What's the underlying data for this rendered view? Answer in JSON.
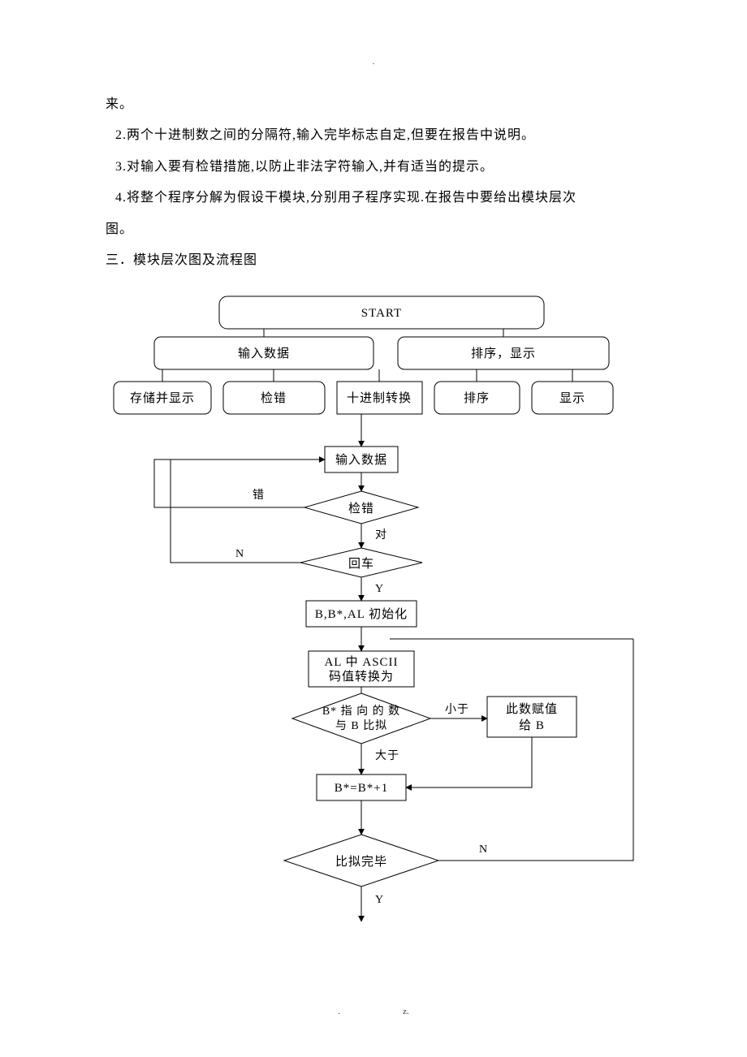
{
  "text": {
    "line0": "来。",
    "line1": "2.两个十进制数之间的分隔符,输入完毕标志自定,但要在报告中说明。",
    "line2": "3.对输入要有检错措施,以防止非法字符输入,并有适当的提示。",
    "line3": "4.将整个程序分解为假设干模块,分别用子程序实现.在报告中要给出模块层次",
    "line4": "图。",
    "sect": "三．模块层次图及流程图"
  },
  "hierarchy": {
    "top": "START",
    "mid_left": "输入数据",
    "mid_right": "排序，显示",
    "b1": "存储并显示",
    "b2": "检错",
    "b3": "十进制转换",
    "b4": "排序",
    "b5": "显示"
  },
  "flow": {
    "n_input": "输入数据",
    "n_check": "检错",
    "lbl_err": "错",
    "lbl_ok": "对",
    "n_enter": "回车",
    "lbl_N": "N",
    "lbl_Y": "Y",
    "n_init": "B,B*,AL 初始化",
    "n_conv1": "AL 中 ASCII",
    "n_conv2": "码值转换为",
    "n_cmp1": "B* 指 向 的 数",
    "n_cmp2": "与 B 比拟",
    "lbl_lt": "小于",
    "lbl_gt": "大于",
    "n_assign1": "此数赋值",
    "n_assign2": "给 B",
    "n_inc": "B*=B*+1",
    "n_done": "比拟完毕",
    "lbl_N2": "N",
    "lbl_Y2": "Y"
  },
  "footer": "z.",
  "topdot": "."
}
